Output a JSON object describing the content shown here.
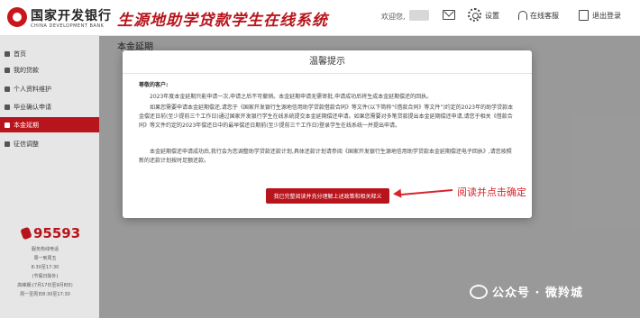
{
  "header": {
    "bank_name": "国家开发银行",
    "bank_sub": "CHINA DEVELOPMENT BANK",
    "system_title": "生源地助学贷款学生在线系统",
    "welcome": "欢迎您,",
    "settings_label": "设置",
    "service_label": "在线客服",
    "logout_label": "退出登录"
  },
  "sidebar": {
    "items": [
      {
        "label": "首页",
        "icon": "home-icon"
      },
      {
        "label": "我的贷款",
        "icon": "loan-icon"
      },
      {
        "label": "个人资料维护",
        "icon": "profile-icon"
      },
      {
        "label": "毕业确认申请",
        "icon": "graduation-icon"
      },
      {
        "label": "本金延期",
        "icon": "extension-icon",
        "active": true
      },
      {
        "label": "征信调整",
        "icon": "credit-icon"
      }
    ],
    "hotline": "95593",
    "info": [
      "服务热线电话",
      "周一到周五",
      "8:30至17:30",
      "(节假日除外)",
      "高峰期:(7月17日至9月8日)",
      "周一至周日8:30至17:30"
    ]
  },
  "main": {
    "page_title": "本金延期"
  },
  "modal": {
    "title": "温馨提示",
    "greeting": "尊敬的客户:",
    "paragraphs": [
      "2023年度本金延期只能申请一次,申请之后不可撤销。本金延期申请无需审批,申请成功后将生成本金延期偿还的回执。",
      "如果您需要申请本金延期偿还,请您于《国家开发银行生源地信用助学贷款借款合同》等文件(以下简称“《借款合同》等文件”)约定的2023年的助学贷款本金偿还日前(至少提前三个工作日)通过国家开发银行学生在线系统提交本金延期偿还申请。如果您需要对多笔贷款提出本金延期偿还申请,请您于相关《借款合同》等文件约定的2023年偿还日中的最早偿还日期前(至少提前三个工作日)登录学生在线系统一并提出申请。",
      "本金延期偿还申请成功后,我行会为您调整助学贷款还款计划,具体还款计划请参阅《国家开发银行生源地信用助学贷款本金延期偿还电子回执》,请您按照新的还款计划按时足额还款。"
    ],
    "confirm_button": "我已完整阅读并充分理解上述政策和相关释义"
  },
  "annotation": {
    "text": "阅读并点击确定"
  },
  "watermark": {
    "text": "公众号 · 微羚城"
  },
  "colors": {
    "brand_red": "#b8141b",
    "annotation_red": "#d9242b"
  }
}
